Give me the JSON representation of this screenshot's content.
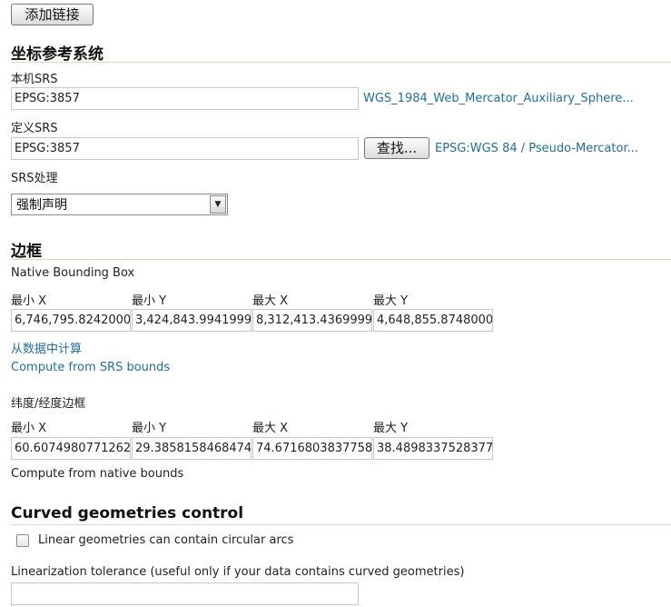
{
  "add_link_button": "添加链接",
  "crs": {
    "title": "坐标参考系统",
    "native_srs_label": "本机SRS",
    "native_srs_value": "EPSG:3857",
    "native_srs_link": "WGS_1984_Web_Mercator_Auxiliary_Sphere...",
    "declared_srs_label": "定义SRS",
    "declared_srs_value": "EPSG:3857",
    "find_button": "查找...",
    "declared_srs_link": "EPSG:WGS 84 / Pseudo-Mercator...",
    "srs_handling_label": "SRS处理",
    "srs_handling_value": "强制声明"
  },
  "bbox": {
    "title": "边框",
    "native_label": "Native Bounding Box",
    "col_min_x": "最小 X",
    "col_min_y": "最小 Y",
    "col_max_x": "最大 X",
    "col_max_y": "最大 Y",
    "native_min_x": "6,746,795.8242000",
    "native_min_y": "3,424,843.9941999",
    "native_max_x": "8,312,413.4369999",
    "native_max_y": "4,648,855.8748000",
    "compute_from_data": "从数据中计算",
    "compute_from_srs": "Compute from SRS bounds",
    "latlon_label": "纬度/经度边框",
    "latlon_min_x": "60.6074980771262",
    "latlon_min_y": "29.3858158468474",
    "latlon_max_x": "74.6716803837758",
    "latlon_max_y": "38.4898337528377",
    "compute_from_native": "Compute from native bounds"
  },
  "curved": {
    "title": "Curved geometries control",
    "checkbox_label": "Linear geometries can contain circular arcs",
    "tolerance_label": "Linearization tolerance (useful only if your data contains curved geometries)",
    "tolerance_value": ""
  }
}
